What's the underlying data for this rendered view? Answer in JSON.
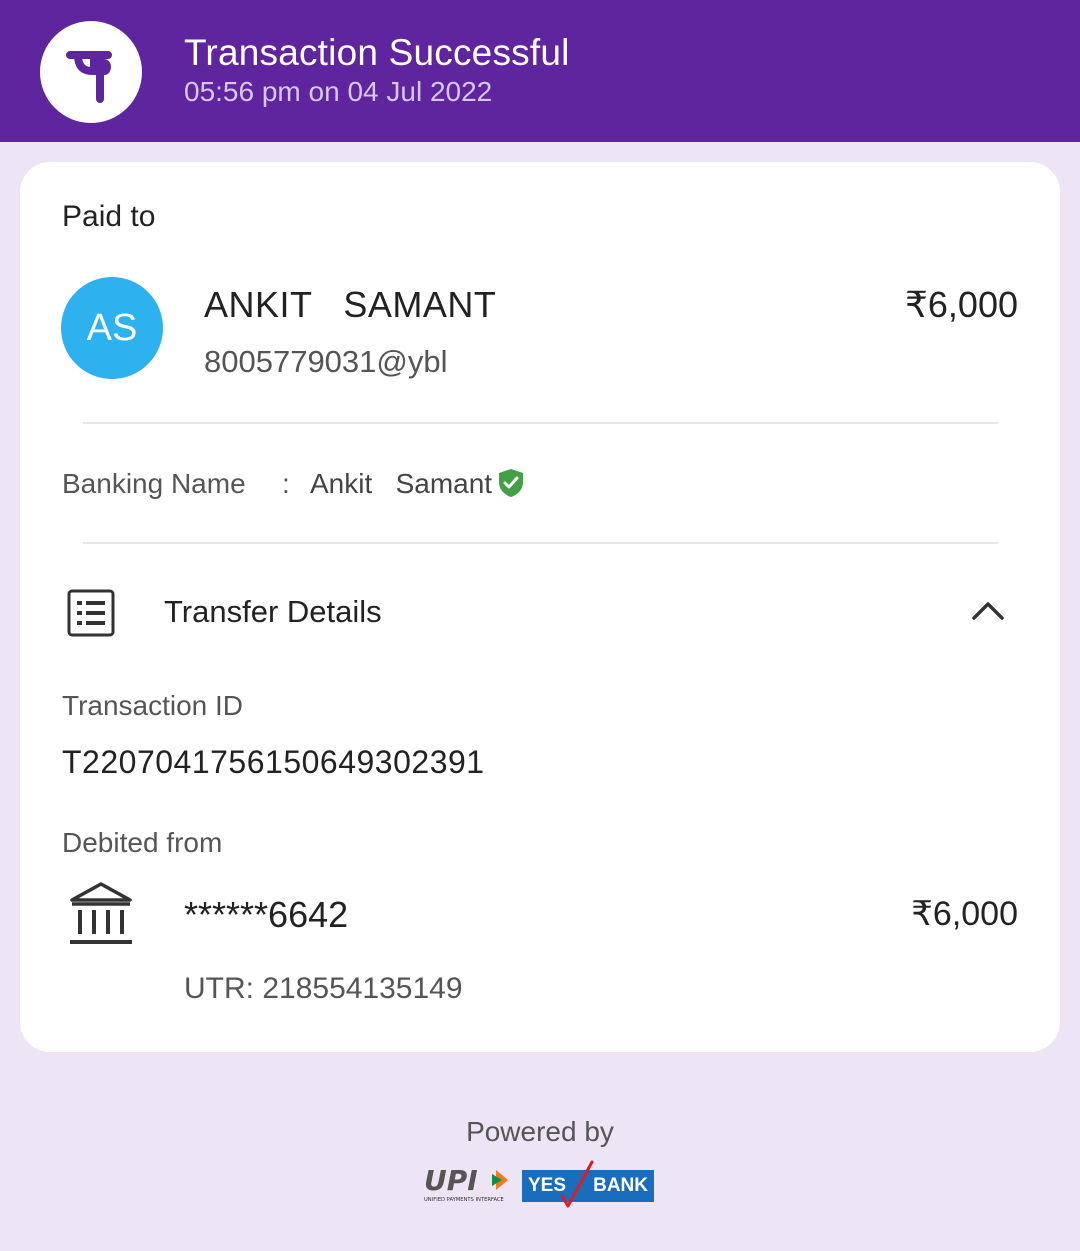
{
  "header": {
    "title": "Transaction Successful",
    "subtitle": "05:56 pm on 04 Jul 2022",
    "logo_icon": "phonepe-logo",
    "bg_color": "#5f259f"
  },
  "card": {
    "paid_to_label": "Paid to",
    "payee": {
      "initials": "AS",
      "name": "ANKIT   SAMANT",
      "upi_id": "8005779031@ybl",
      "amount": "₹6,000",
      "avatar_color": "#2db2ef"
    },
    "banking_name": {
      "label": "Banking Name",
      "separator": ":",
      "value": "Ankit   Samant",
      "verified_icon": "shield-check-icon"
    },
    "transfer_details": {
      "title": "Transfer Details",
      "icon": "receipt-list-icon",
      "toggle_icon": "chevron-up-icon",
      "transaction_id_label": "Transaction ID",
      "transaction_id": "T2207041756150649302391",
      "debited_from_label": "Debited from",
      "account": "******6642",
      "debit_amount": "₹6,000",
      "utr": "UTR: 218554135149",
      "bank_icon": "bank-icon"
    }
  },
  "footer": {
    "powered_by": "Powered by",
    "upi_logo_text": "UPI",
    "upi_tagline": "UNIFIED PAYMENTS INTERFACE",
    "bank_logo": {
      "left": "YES",
      "right": "BANK"
    }
  }
}
